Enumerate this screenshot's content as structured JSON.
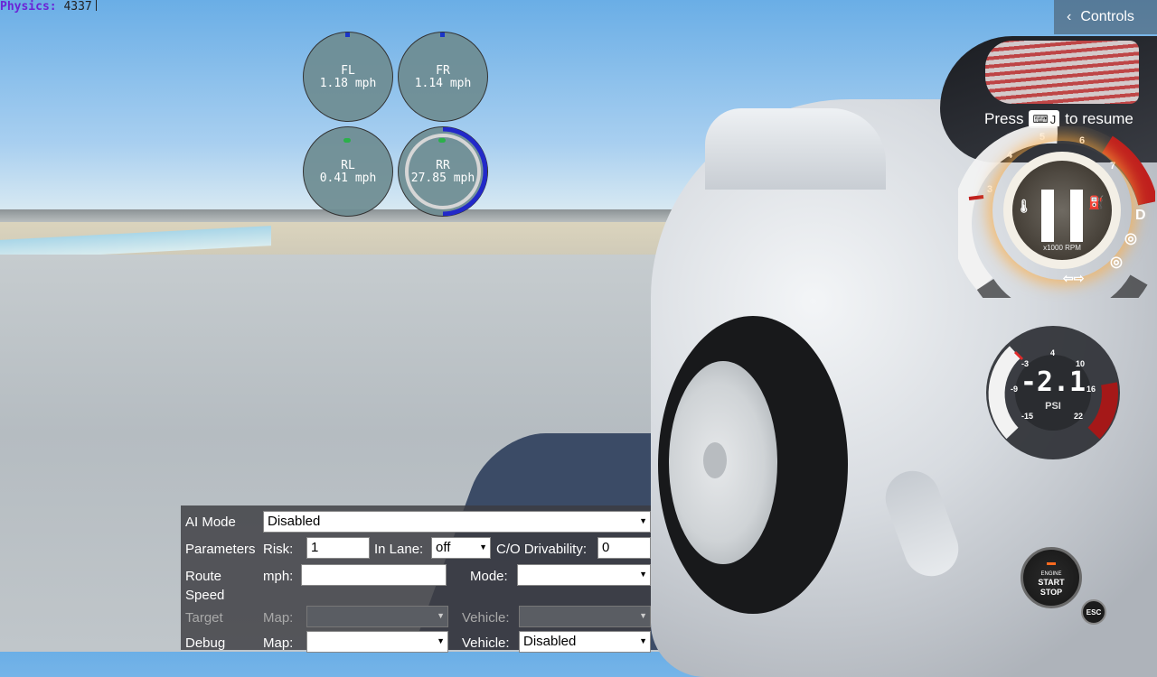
{
  "fps": {
    "label": "Physics:",
    "value": "4337"
  },
  "wheels": [
    {
      "label": "FL",
      "speed": "1.18 mph"
    },
    {
      "label": "FR",
      "speed": "1.14 mph"
    },
    {
      "label": "RL",
      "speed": "0.41 mph"
    },
    {
      "label": "RR",
      "speed": "27.85 mph"
    }
  ],
  "controls_button": {
    "label": "Controls",
    "icon": "chevron-left-icon"
  },
  "resume_prompt": {
    "prefix": "Press",
    "key": "J",
    "suffix": "to resume"
  },
  "tachometer": {
    "tick_labels": [
      "3",
      "4",
      "5",
      "6",
      "7"
    ],
    "unit": "x1000 RPM",
    "redline_color": "#c0201e"
  },
  "boost_gauge": {
    "value": "-2.1",
    "unit": "PSI",
    "tick_labels": [
      "-15",
      "-9",
      "-3",
      "4",
      "10",
      "16",
      "22"
    ]
  },
  "engine_button": {
    "line1": "ENGINE",
    "line2": "START",
    "line3": "STOP"
  },
  "esc_button": {
    "label": "ESC"
  },
  "ai_panel": {
    "ai_mode": {
      "label": "AI Mode",
      "value": "Disabled"
    },
    "parameters": {
      "label": "Parameters",
      "risk_label": "Risk:",
      "risk_value": "1",
      "in_lane_label": "In Lane:",
      "in_lane_value": "off",
      "drivability_label": "C/O Drivability:",
      "drivability_value": "0"
    },
    "route_speed": {
      "label_line1": "Route",
      "label_line2": "Speed",
      "mph_label": "mph:",
      "mph_value": "",
      "mode_label": "Mode:",
      "mode_value": ""
    },
    "target": {
      "label": "Target",
      "map_label": "Map:",
      "map_value": "",
      "vehicle_label": "Vehicle:",
      "vehicle_value": ""
    },
    "debug": {
      "label": "Debug",
      "map_label": "Map:",
      "map_value": "",
      "vehicle_label": "Vehicle:",
      "vehicle_value": "Disabled"
    }
  }
}
